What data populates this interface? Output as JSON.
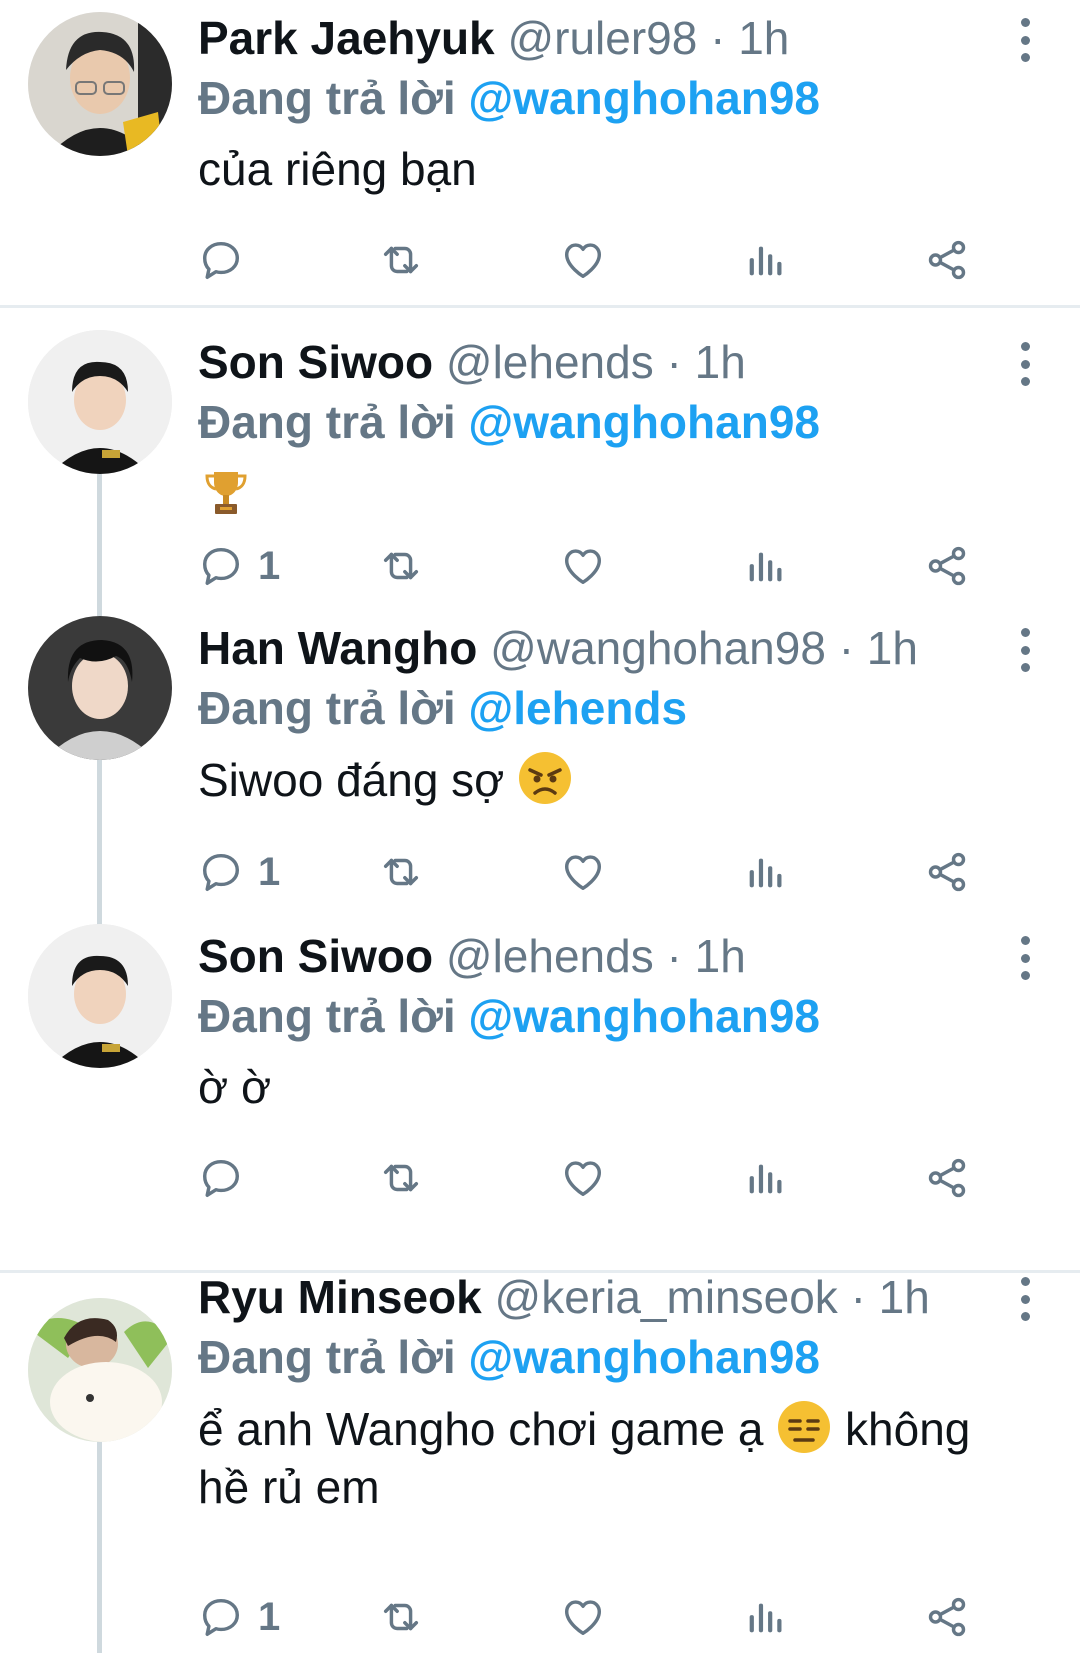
{
  "icons": {
    "reply": "reply-bubble-icon",
    "retweet": "retweet-icon",
    "like": "heart-icon",
    "analytics": "analytics-bars-icon",
    "share": "share-icon",
    "more": "more-vertical-icon"
  },
  "colors": {
    "link": "#1da1f2",
    "muted": "#657786",
    "text": "#0f1419",
    "divider": "#e6ecf0",
    "thread": "#cfd9de"
  },
  "tweets": [
    {
      "name": "Park Jaehyuk",
      "handle": "@ruler98",
      "time": "· 1h",
      "reply_prefix": "Đang trả lời",
      "reply_to": "@wanghohan98",
      "text": "của riêng bạn",
      "reply_count": ""
    },
    {
      "name": "Son Siwoo",
      "handle": "@lehends",
      "time": "· 1h",
      "reply_prefix": "Đang trả lời",
      "reply_to": "@wanghohan98",
      "emoji": "trophy-emoji",
      "reply_count": "1"
    },
    {
      "name": "Han Wangho",
      "handle": "@wanghohan98",
      "time": "· 1h",
      "reply_prefix": "Đang trả lời",
      "reply_to": "@lehends",
      "text": "Siwoo đáng sợ",
      "emoji": "angry-face-emoji",
      "reply_count": "1"
    },
    {
      "name": "Son Siwoo",
      "handle": "@lehends",
      "time": "· 1h",
      "reply_prefix": "Đang trả lời",
      "reply_to": "@wanghohan98",
      "text": "ờ ờ",
      "reply_count": ""
    },
    {
      "name": "Ryu Minseok",
      "handle": "@keria_minseok",
      "time": "· 1h",
      "reply_prefix": "Đang trả lời",
      "reply_to": "@wanghohan98",
      "text_before": "ể anh Wangho chơi game ạ",
      "emoji": "expressionless-face-emoji",
      "text_after": "không hề rủ em",
      "reply_count": "1"
    }
  ]
}
